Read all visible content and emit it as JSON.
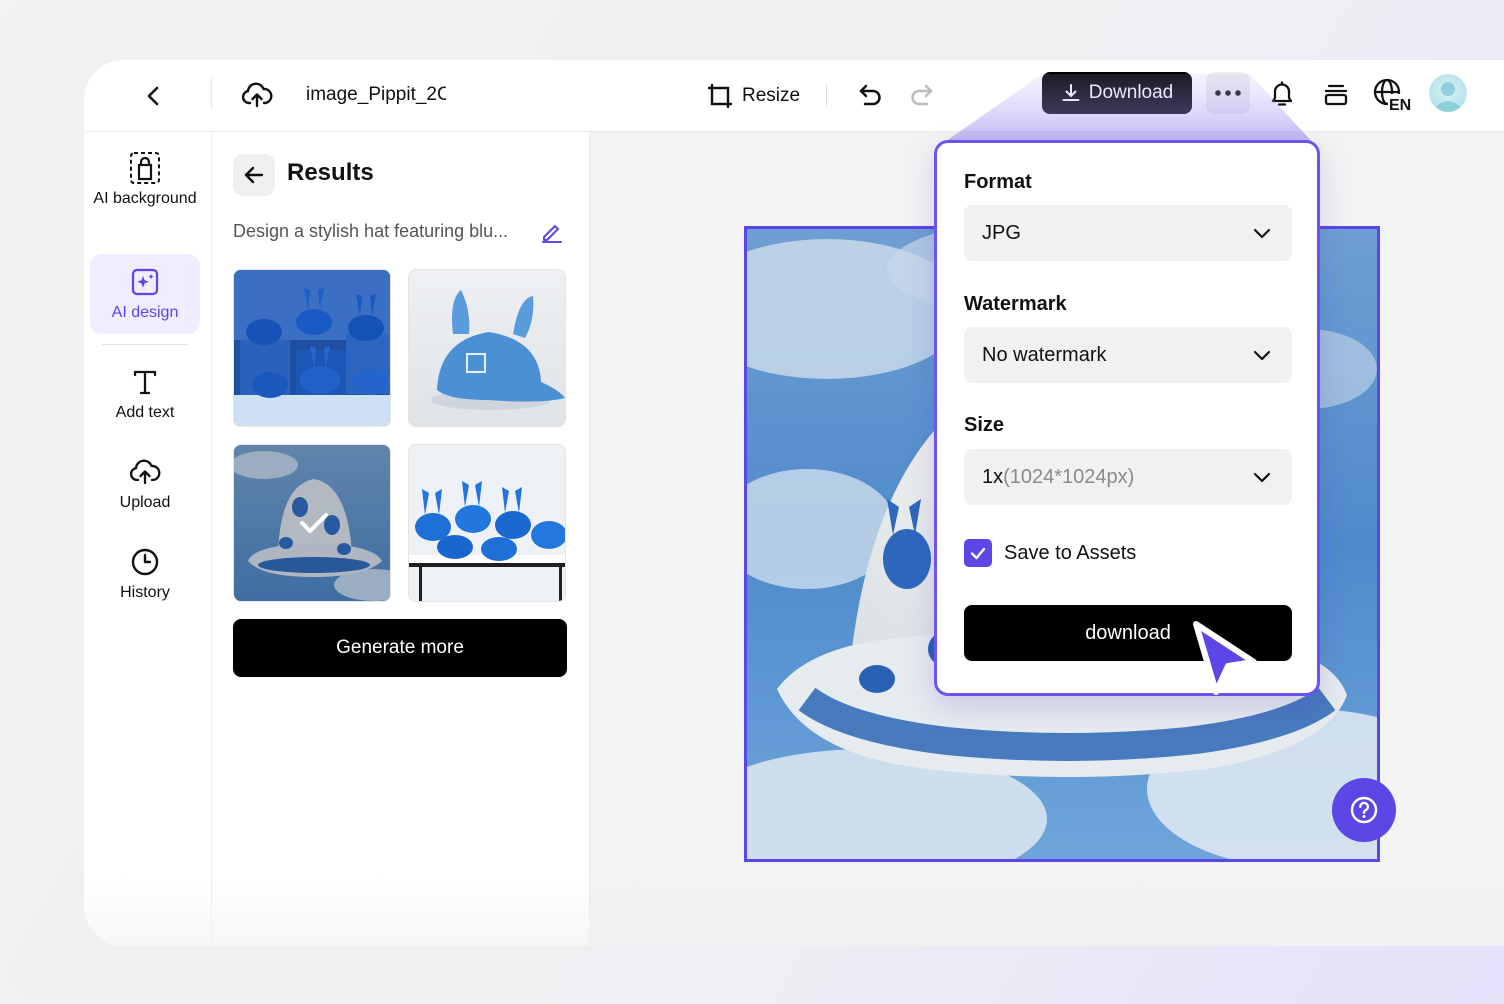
{
  "header": {
    "file_name": "image_Pippit_2C",
    "resize_label": "Resize",
    "download_label": "Download"
  },
  "language": {
    "code": "EN"
  },
  "rail": {
    "items": [
      {
        "label": "AI background"
      },
      {
        "label": "AI design"
      },
      {
        "label": "Add text"
      },
      {
        "label": "Upload"
      },
      {
        "label": "History"
      }
    ]
  },
  "panel": {
    "title": "Results",
    "prompt": "Design a stylish hat featuring blu...",
    "generate_label": "Generate more",
    "selected_thumbnail": 3
  },
  "download_popover": {
    "format_label": "Format",
    "format_value": "JPG",
    "watermark_label": "Watermark",
    "watermark_value": "No watermark",
    "size_label": "Size",
    "size_value": "1x",
    "size_suffix": "(1024*1024px)",
    "save_assets_label": "Save to Assets",
    "save_assets_checked": true,
    "download_label": "download"
  },
  "colors": {
    "accent": "#5b46e6",
    "primary_button": "#000000",
    "select_bg": "#f1f1f3"
  },
  "icons": {
    "back": "chevron-left-icon",
    "upload_cloud": "cloud-upload-icon",
    "resize": "resize-icon",
    "undo": "undo-icon",
    "redo": "redo-icon",
    "download": "download-icon",
    "more": "more-dots-icon",
    "bell": "bell-icon",
    "layers": "layers-icon",
    "language": "globe-icon",
    "help": "help-icon"
  }
}
